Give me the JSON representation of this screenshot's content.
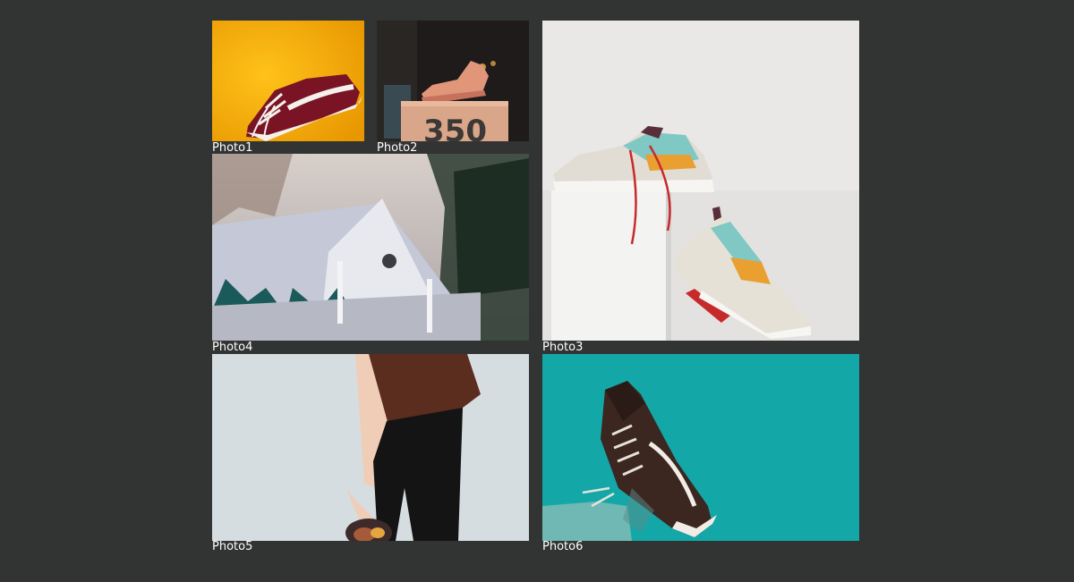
{
  "gallery": {
    "photos": [
      {
        "caption": "Photo1",
        "subject": "burgundy skate sneaker on orange background"
      },
      {
        "caption": "Photo2",
        "subject": "peach knit sneaker on box printed 350"
      },
      {
        "caption": "Photo3",
        "subject": "two multicolor chunky sneakers on white pedestal"
      },
      {
        "caption": "Photo4",
        "subject": "blurred white church roof with trees"
      },
      {
        "caption": "Photo5",
        "subject": "person holding shoes in hand"
      },
      {
        "caption": "Photo6",
        "subject": "dark skate sneaker against teal background"
      }
    ],
    "box_print": "350"
  },
  "colors": {
    "page_background": "#323333",
    "caption_text": "#ffffff",
    "photo1_bg": "#f4a900",
    "photo2_bg": "#1e1b1a",
    "photo3_bg": "#e9e8e7",
    "photo4_bg": "#c9c6c4",
    "photo5_bg": "#d6dde0",
    "photo6_bg": "#14a7a8"
  }
}
